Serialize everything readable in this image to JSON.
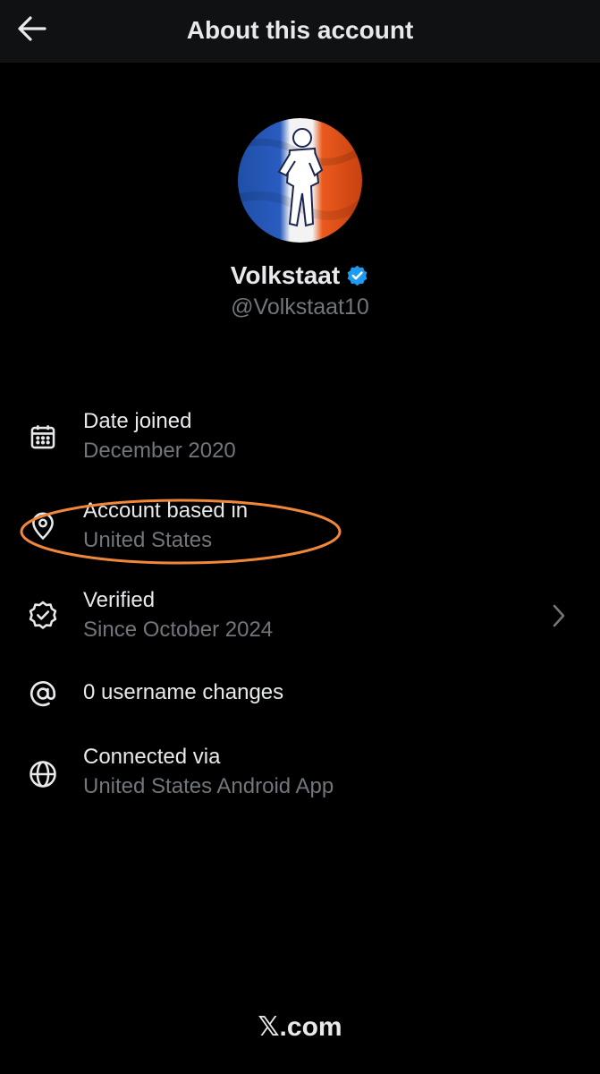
{
  "header": {
    "title": "About this account",
    "back_icon": "arrow-left-icon"
  },
  "profile": {
    "display_name": "Volkstaat",
    "handle": "@Volkstaat10",
    "verified": true,
    "badge_color": "#1d9bf0",
    "avatar_colors": [
      "#1f4fa8",
      "#ffffff",
      "#e8541c"
    ]
  },
  "details": [
    {
      "icon": "calendar-icon",
      "title": "Date joined",
      "subtitle": "December 2020"
    },
    {
      "icon": "location-pin-icon",
      "title": "Account based in",
      "subtitle": "United States",
      "highlighted": true
    },
    {
      "icon": "verified-check-icon",
      "title": "Verified",
      "subtitle": "Since October 2024",
      "has_chevron": true
    },
    {
      "icon": "at-sign-icon",
      "title": "0 username changes"
    },
    {
      "icon": "globe-icon",
      "title": "Connected via",
      "subtitle": "United States Android App"
    }
  ],
  "highlight_color": "#f0873a",
  "footer": {
    "brand": "𝕏.com"
  },
  "colors": {
    "background": "#000000",
    "primary_text": "#e7e9ea",
    "secondary_text": "#71767b"
  }
}
